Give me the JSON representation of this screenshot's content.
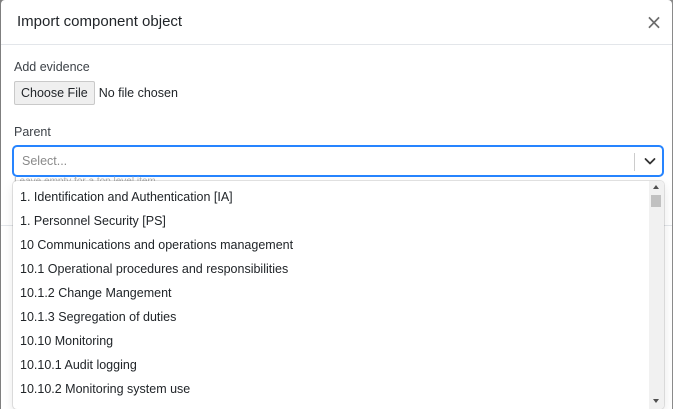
{
  "modal": {
    "title": "Import component object",
    "close_label": "×"
  },
  "evidence": {
    "label": "Add evidence",
    "choose_file_label": "Choose File",
    "file_status": "No file chosen"
  },
  "parent": {
    "label": "Parent",
    "placeholder": "Select...",
    "value": "",
    "hint": "Leave empty for a top level item"
  },
  "dropdown": {
    "options": [
      "1. Identification and Authentication [IA]",
      "1. Personnel Security [PS]",
      "10 Communications and operations management",
      "10.1 Operational procedures and responsibilities",
      "10.1.2 Change Mangement",
      "10.1.3 Segregation of duties",
      "10.10 Monitoring",
      "10.10.1 Audit logging",
      "10.10.2 Monitoring system use"
    ]
  },
  "colors": {
    "focus_border": "#2684ff",
    "backdrop": "#8a8a8a"
  }
}
